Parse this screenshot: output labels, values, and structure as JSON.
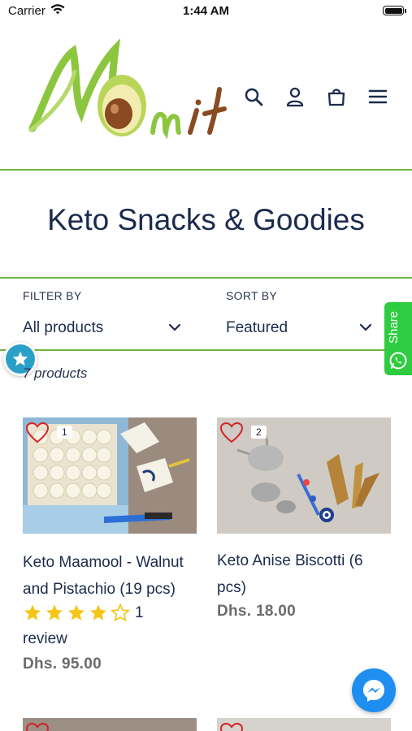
{
  "status_bar": {
    "carrier": "Carrier",
    "time": "1:44 AM"
  },
  "header": {
    "logo_text": "Mom it",
    "icons": [
      "search-icon",
      "account-icon",
      "cart-icon",
      "menu-icon"
    ]
  },
  "page": {
    "title": "Keto Snacks & Goodies"
  },
  "filter": {
    "label": "FILTER BY",
    "value": "All products"
  },
  "sort": {
    "label": "SORT BY",
    "value": "Featured"
  },
  "share_tab": {
    "label": "Share"
  },
  "products_count": "7 products",
  "products": [
    {
      "badge": "1",
      "name_line1": "Keto Maamool - Walnut",
      "name_line2": "and Pistachio (19 pcs)",
      "rating": 4,
      "review_count": "1",
      "review_word": "review",
      "price": "Dhs. 95.00"
    },
    {
      "badge": "2",
      "name_line1": "Keto Anise Biscotti (6",
      "name_line2": "pcs)",
      "price": "Dhs. 18.00"
    }
  ],
  "colors": {
    "accent_green": "#6fb33f",
    "title_navy": "#1c2b4d",
    "star": "#f5c518",
    "whatsapp": "#2ecc40",
    "messenger": "#1e8ef0"
  }
}
